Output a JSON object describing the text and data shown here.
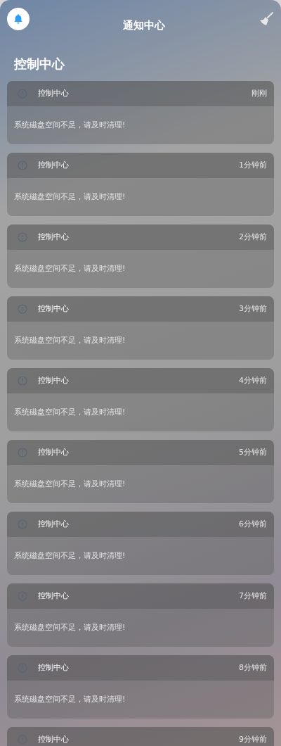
{
  "header": {
    "title": "通知中心"
  },
  "section": {
    "title": "控制中心"
  },
  "notifications": [
    {
      "app": "控制中心",
      "time": "刚刚",
      "message": "系统磁盘空间不足，请及时清理!"
    },
    {
      "app": "控制中心",
      "time": "1分钟前",
      "message": "系统磁盘空间不足，请及时清理!"
    },
    {
      "app": "控制中心",
      "time": "2分钟前",
      "message": "系统磁盘空间不足，请及时清理!"
    },
    {
      "app": "控制中心",
      "time": "3分钟前",
      "message": "系统磁盘空间不足，请及时清理!"
    },
    {
      "app": "控制中心",
      "time": "4分钟前",
      "message": "系统磁盘空间不足，请及时清理!"
    },
    {
      "app": "控制中心",
      "time": "5分钟前",
      "message": "系统磁盘空间不足，请及时清理!"
    },
    {
      "app": "控制中心",
      "time": "6分钟前",
      "message": "系统磁盘空间不足，请及时清理!"
    },
    {
      "app": "控制中心",
      "time": "7分钟前",
      "message": "系统磁盘空间不足，请及时清理!"
    },
    {
      "app": "控制中心",
      "time": "8分钟前",
      "message": "系统磁盘空间不足，请及时清理!"
    },
    {
      "app": "控制中心",
      "time": "9分钟前"
    }
  ]
}
